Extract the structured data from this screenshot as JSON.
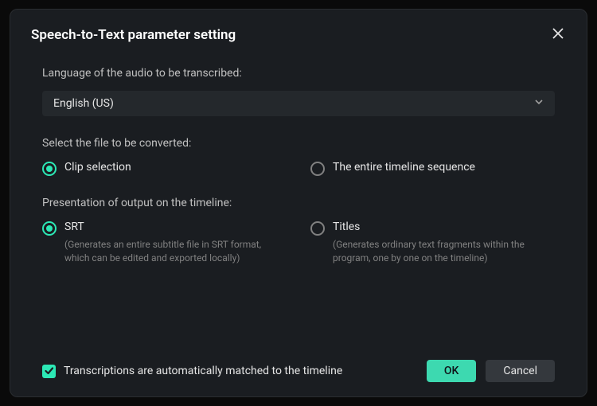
{
  "modal": {
    "title": "Speech-to-Text parameter setting"
  },
  "language": {
    "label": "Language of the audio to be transcribed:",
    "selected": "English (US)"
  },
  "file_selection": {
    "label": "Select the file to be converted:",
    "options": {
      "clip": "Clip selection",
      "timeline": "The entire timeline sequence"
    }
  },
  "presentation": {
    "label": "Presentation of output on the timeline:",
    "srt": {
      "label": "SRT",
      "desc": "(Generates an entire subtitle file in SRT format, which can be edited and exported locally)"
    },
    "titles": {
      "label": "Titles",
      "desc": "(Generates ordinary text fragments within the program, one by one on the timeline)"
    }
  },
  "checkbox": {
    "label": "Transcriptions are automatically matched to the timeline"
  },
  "buttons": {
    "ok": "OK",
    "cancel": "Cancel"
  }
}
